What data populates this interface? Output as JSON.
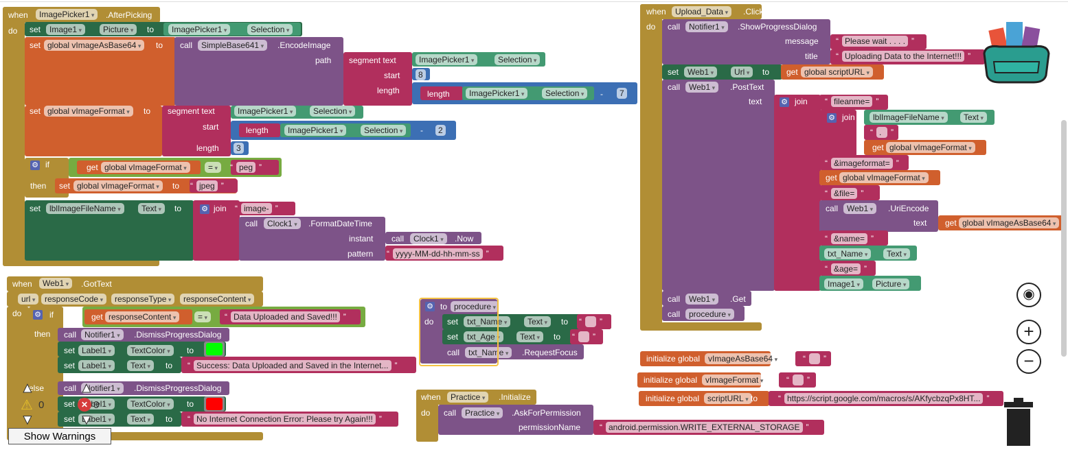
{
  "after_picking": [
    "when",
    "ImagePicker1",
    ".AfterPicking",
    "do",
    "set",
    "Image1",
    "Picture",
    "to",
    "ImagePicker1",
    "Selection",
    "set",
    "global vImageAsBase64",
    "to",
    "call",
    "SimpleBase641",
    ".EncodeImage",
    "path",
    "segment  text",
    "ImagePicker1",
    "Selection",
    "start",
    "8",
    "length",
    "length",
    "ImagePicker1",
    "Selection",
    "-",
    "7",
    "set",
    "global vImageFormat",
    "to",
    "segment  text",
    "ImagePicker1",
    "Selection",
    "start",
    "length",
    "ImagePicker1",
    "Selection",
    "-",
    "2",
    "length",
    "3",
    "if",
    "get",
    "global vImageFormat",
    "=",
    "peg",
    "then",
    "set",
    "global vImageFormat",
    "to",
    "jpeg",
    "set",
    "lblImageFileName",
    "Text",
    "to",
    "join",
    "image-",
    "call",
    "Clock1",
    ".FormatDateTime",
    "instant",
    "call",
    "Clock1",
    ".Now",
    "pattern",
    "yyyy-MM-dd-hh-mm-ss"
  ],
  "got_text": [
    "when",
    "Web1",
    ".GotText",
    "url",
    "responseCode",
    "responseType",
    "responseContent",
    "do",
    "if",
    "get",
    "responseContent",
    "=",
    "Data Uploaded and Saved!!!",
    "then",
    "call",
    "Notifier1",
    ".DismissProgressDialog",
    "set",
    "Label1",
    "TextColor",
    "to",
    "set",
    "Label1",
    "Text",
    "to",
    "Success: Data Uploaded and Saved in the Internet...",
    "else",
    "call",
    "Notifier1",
    ".DismissProgressDialog",
    "set",
    "Label1",
    "TextColor",
    "to",
    "set",
    "Label1",
    "Text",
    "to",
    "No Internet Connection Error: Please try Again!!!"
  ],
  "procedure": [
    "to",
    "procedure",
    "do",
    "set",
    "txt_Name",
    "Text",
    "to",
    "",
    "set",
    "txt_Age",
    "Text",
    "to",
    "",
    "call",
    "txt_Name",
    ".RequestFocus"
  ],
  "practice": [
    "when",
    "Practice",
    ".Initialize",
    "do",
    "call",
    "Practice",
    ".AskForPermission",
    "permissionName",
    "android.permission.WRITE_EXTERNAL_STORAGE"
  ],
  "upload": [
    "when",
    "Upload_Data",
    ".Click",
    "do",
    "call",
    "Notifier1",
    ".ShowProgressDialog",
    "message",
    "Please wait . . . .",
    "title",
    "Uploading Data to the Internet!!!",
    "set",
    "Web1",
    "Url",
    "to",
    "get",
    "global scriptURL",
    "call",
    "Web1",
    ".PostText",
    "text",
    "join",
    "fileanme=",
    "join",
    "lblImageFileName",
    "Text",
    ".",
    "get",
    "global vImageFormat",
    "&imageformat=",
    "get",
    "global vImageFormat",
    "&file=",
    "call",
    "Web1",
    ".UriEncode",
    "text",
    "get",
    "global vImageAsBase64",
    "&name=",
    "txt_Name",
    "Text",
    "&age=",
    "Image1",
    "Picture",
    "call",
    "Web1",
    ".Get",
    "call",
    "procedure"
  ],
  "globals": [
    "initialize global",
    "vImageAsBase64",
    "to",
    "",
    "initialize global",
    "vImageFormat",
    "to",
    "",
    "initialize global",
    "scriptURL",
    "to",
    "https://script.google.com/macros/s/AKfycbzqPx8HT..."
  ],
  "colors": {
    "event": "#b18e35",
    "set_component": "#2a6a47",
    "get_component": "#439a72",
    "variable": "#d05f2d",
    "procedure": "#7d5388",
    "text": "#b12f5d",
    "math": "#3c6fb4",
    "logic": "#77ab41",
    "text_color_success": "#00ff00",
    "text_color_error": "#ff0000"
  },
  "workspace": {
    "warning_count": "0",
    "error_count": "0",
    "show_warnings_label": "Show Warnings",
    "icons": [
      "backpack-icon",
      "locate-icon",
      "zoom-in-icon",
      "zoom-out-icon",
      "trash-icon",
      "warning-icon",
      "error-icon"
    ]
  }
}
